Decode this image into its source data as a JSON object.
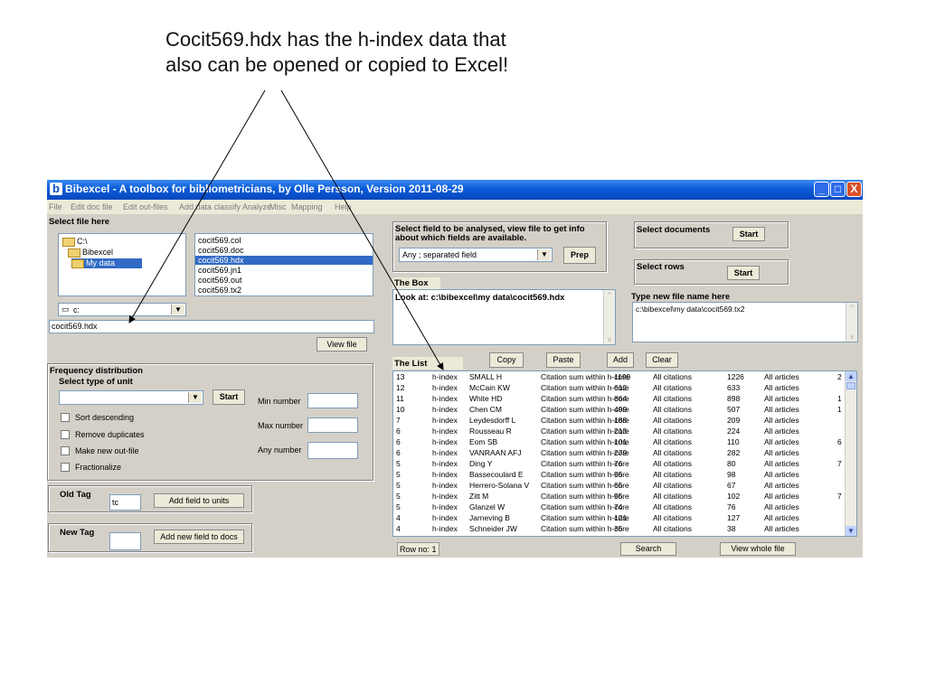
{
  "caption": [
    "Cocit569.hdx has the h-index data that",
    "also can be opened or copied to Excel!"
  ],
  "window": {
    "title": "Bibexcel - A toolbox for bibliometricians, by Olle Persson, Version 2011-08-29",
    "buttons": {
      "min": "_",
      "max": "□",
      "close": "X"
    }
  },
  "menu": [
    "File",
    "Edit doc file",
    "Edit out-files",
    "Add data classify",
    "Analyze",
    "Misc",
    "Mapping",
    "Help"
  ],
  "select_file": {
    "label": "Select file here",
    "dirs": [
      "C:\\",
      "Bibexcel",
      "My data"
    ],
    "files": [
      "cocit569.col",
      "cocit569.doc",
      "cocit569.hdx",
      "cocit569.jn1",
      "cocit569.out",
      "cocit569.tx2"
    ],
    "selected_file_index": 2,
    "drive": "c:",
    "filename": "cocit569.hdx",
    "view_button": "View file"
  },
  "freq": {
    "label": "Frequency distribution",
    "sublabel": "Select type of unit",
    "start": "Start",
    "checks": [
      "Sort descending",
      "Remove duplicates",
      "Make new out-file",
      "Fractionalize"
    ],
    "min_label": "Min number",
    "max_label": "Max number",
    "any_label": "Any number"
  },
  "old_tag": {
    "label": "Old Tag",
    "value": "tc",
    "button": "Add field to units"
  },
  "new_tag": {
    "label": "New Tag",
    "value": "",
    "button": "Add new field to docs"
  },
  "select_field": {
    "label1": "Select field to be analysed, view file to get info",
    "label2": "about which fields are available.",
    "combo": "Any ; separated field",
    "prep": "Prep"
  },
  "select_docs": {
    "label": "Select documents",
    "start": "Start"
  },
  "select_rows": {
    "label": "Select rows",
    "start": "Start"
  },
  "box": {
    "label": "The Box",
    "text": "Look at: c:\\bibexcel\\my data\\cocit569.hdx"
  },
  "newfile": {
    "label": "Type new file name here",
    "text": "c:\\bibexcel\\my data\\cocit569.tx2"
  },
  "list": {
    "label": "The List",
    "buttons": [
      "Copy",
      "Paste",
      "Add",
      "Clear"
    ],
    "rows": [
      [
        "13",
        "h-index",
        "SMALL H",
        "Citation sum within h-core",
        "1199",
        "All citations",
        "1226",
        "All articles",
        "2"
      ],
      [
        "12",
        "h-index",
        "McCain KW",
        "Citation sum within h-core",
        "612",
        "All citations",
        "633",
        "All articles",
        ""
      ],
      [
        "11",
        "h-index",
        "White HD",
        "Citation sum within h-core",
        "864",
        "All citations",
        "898",
        "All articles",
        "1"
      ],
      [
        "10",
        "h-index",
        "Chen CM",
        "Citation sum within h-core",
        "499",
        "All citations",
        "507",
        "All articles",
        "1"
      ],
      [
        "7",
        "h-index",
        "Leydesdorff L",
        "Citation sum within h-core",
        "188",
        "All citations",
        "209",
        "All articles",
        ""
      ],
      [
        "6",
        "h-index",
        "Rousseau R",
        "Citation sum within h-core",
        "213",
        "All citations",
        "224",
        "All articles",
        ""
      ],
      [
        "6",
        "h-index",
        "Eom SB",
        "Citation sum within h-core",
        "101",
        "All citations",
        "110",
        "All articles",
        "6"
      ],
      [
        "6",
        "h-index",
        "VANRAAN AFJ",
        "Citation sum within h-core",
        "279",
        "All citations",
        "282",
        "All articles",
        ""
      ],
      [
        "5",
        "h-index",
        "Ding Y",
        "Citation sum within h-core",
        "76",
        "All citations",
        "80",
        "All articles",
        "7"
      ],
      [
        "5",
        "h-index",
        "Bassecoulard E",
        "Citation sum within h-core",
        "95",
        "All citations",
        "98",
        "All articles",
        ""
      ],
      [
        "5",
        "h-index",
        "Herrero-Solana V",
        "Citation sum within h-core",
        "65",
        "All citations",
        "67",
        "All articles",
        ""
      ],
      [
        "5",
        "h-index",
        "Zitt M",
        "Citation sum within h-core",
        "95",
        "All citations",
        "102",
        "All articles",
        "7"
      ],
      [
        "5",
        "h-index",
        "Glanzel W",
        "Citation sum within h-core",
        "74",
        "All citations",
        "76",
        "All articles",
        ""
      ],
      [
        "4",
        "h-index",
        "Jarneving B",
        "Citation sum within h-core",
        "121",
        "All citations",
        "127",
        "All articles",
        ""
      ],
      [
        "4",
        "h-index",
        "Schneider JW",
        "Citation sum within h-core",
        "35",
        "All citations",
        "38",
        "All articles",
        ""
      ]
    ]
  },
  "status": {
    "row": "Row no: 1",
    "search": "Search",
    "view_whole": "View whole file"
  }
}
